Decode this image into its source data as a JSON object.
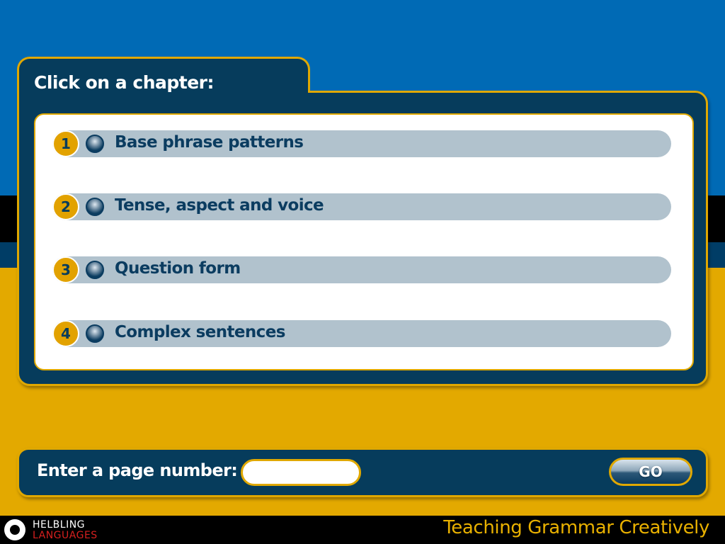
{
  "header": {
    "title": "Click on a chapter:"
  },
  "chapters": [
    {
      "number": "1",
      "label": "Base phrase patterns"
    },
    {
      "number": "2",
      "label": "Tense, aspect and voice"
    },
    {
      "number": "3",
      "label": "Question form"
    },
    {
      "number": "4",
      "label": "Complex sentences"
    }
  ],
  "page_entry": {
    "label": "Enter a page number:",
    "value": "",
    "placeholder": "",
    "go_label": "GO"
  },
  "footer": {
    "logo_top": "HELBLING",
    "logo_bottom": "LANGUAGES",
    "title": "Teaching Grammar Creatively"
  },
  "colors": {
    "sky_blue": "#006ab5",
    "navy": "#063c5c",
    "gold": "#e3a900",
    "chapter_row": "#b1c2cd"
  }
}
